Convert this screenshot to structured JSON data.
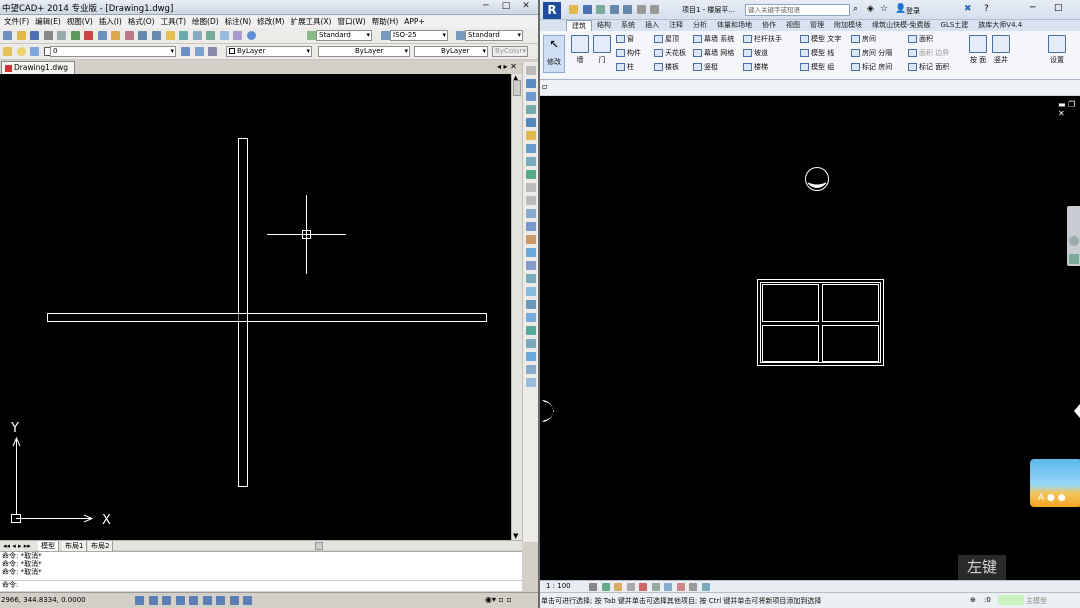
{
  "left_app": {
    "title": "中望CAD+ 2014 专业版 - [Drawing1.dwg]",
    "menu": [
      "文件(F)",
      "编辑(E)",
      "视图(V)",
      "插入(I)",
      "格式(O)",
      "工具(T)",
      "绘图(D)",
      "标注(N)",
      "修改(M)",
      "扩展工具(X)",
      "窗口(W)",
      "帮助(H)",
      "APP+"
    ],
    "toolbar": {
      "text_style": "Standard",
      "dim_style": "ISO-25",
      "table_style": "Standard",
      "layer": "0",
      "color": "ByLayer",
      "linetype": "ByLayer",
      "lineweight": "ByLayer",
      "plotstyle": "ByColor"
    },
    "doc_tab": "Drawing1.dwg",
    "axis": {
      "x": "X",
      "y": "Y"
    },
    "layout_tabs": [
      "模型",
      "布局1",
      "布局2"
    ],
    "command_lines": [
      "命令: *取消*",
      "命令: *取消*",
      "命令: *取消*",
      "命令:"
    ],
    "coordinates": "2966, 344.8334, 0.0000",
    "window_buttons": [
      "─",
      "□",
      "✕"
    ]
  },
  "right_app": {
    "quick_title": "项目1 - 楼层平...",
    "search_placeholder": "键入关键字或短语",
    "login": "登录",
    "tabs": [
      "建筑",
      "结构",
      "系统",
      "插入",
      "注释",
      "分析",
      "体量和场地",
      "协作",
      "视图",
      "管理",
      "附加模块",
      "缘筑山快模-免费版",
      "GLS土建",
      "族库大师V4.4"
    ],
    "active_tab": "建筑",
    "ribbon": {
      "modify": "修改",
      "wall": "墙",
      "door": "门",
      "window": "窗",
      "component": "构件",
      "column": "柱",
      "roof": "屋顶",
      "ceiling": "天花板",
      "floor": "楼板",
      "curtain_system": "幕墙 系统",
      "curtain_grid": "幕墙 网格",
      "mullion": "竖梃",
      "railing": "栏杆扶手",
      "ramp": "坡道",
      "stair": "楼梯",
      "model_text": "模型 文字",
      "model_line": "模型 线",
      "model_group": "模型 组",
      "room": "房间",
      "room_sep": "房间 分隔",
      "tag_room": "标记 房间",
      "area": "面积",
      "area_boundary": "面积 边界",
      "tag_area": "标记 面积",
      "by_face": "按 面",
      "shaft": "竖井",
      "set": "设置"
    },
    "view_scale": "1 : 100",
    "status_message": "单击可进行选择; 按 Tab 键并单击可选择其他项目; 按 Ctrl 键并单击可将新项目添加到选择",
    "status_zero": ":0",
    "status_model": "主模型",
    "key_hint": "左键"
  },
  "colors": {
    "cad_canvas": "#000000",
    "revit_blue": "#1e4d9e",
    "line": "#ffffff"
  }
}
